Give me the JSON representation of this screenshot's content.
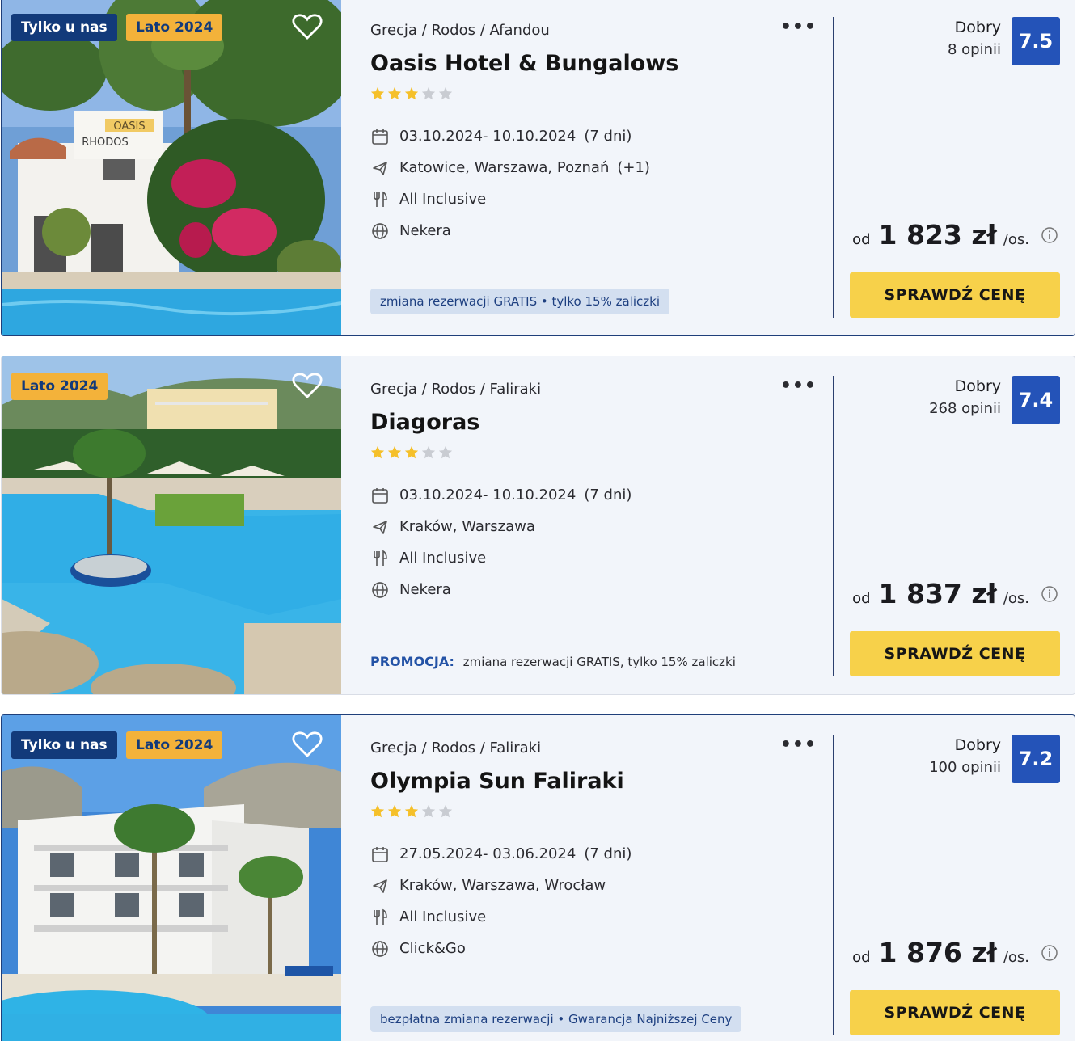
{
  "offers": [
    {
      "badges": {
        "exclusive": "Tylko u nas",
        "season": "Lato 2024"
      },
      "breadcrumb": "Grecja / Rodos / Afandou",
      "name": "Oasis Hotel & Bungalows",
      "stars": 3,
      "dates": "03.10.2024- 10.10.2024",
      "duration": "(7 dni)",
      "departure": "Katowice, Warszawa, Poznań",
      "departure_extra": "(+1)",
      "board": "All Inclusive",
      "operator": "Nekera",
      "promo_text": "zmiana rezerwacji GRATIS • tylko 15% zaliczki",
      "rating_word": "Dobry",
      "rating_count": "8 opinii",
      "score": "7.5",
      "price_prefix": "od",
      "price": "1 823 zł",
      "price_unit": "/os.",
      "cta": "SPRAWDŹ CENĘ",
      "photo_sign_top": "OASIS",
      "photo_sign_bottom": "RHODOS"
    },
    {
      "badges": {
        "season": "Lato 2024"
      },
      "breadcrumb": "Grecja / Rodos / Faliraki",
      "name": "Diagoras",
      "stars": 3,
      "dates": "03.10.2024- 10.10.2024",
      "duration": "(7 dni)",
      "departure": "Kraków, Warszawa",
      "board": "All Inclusive",
      "operator": "Nekera",
      "promo_label": "PROMOCJA:",
      "promo_text": "zmiana rezerwacji GRATIS, tylko 15% zaliczki",
      "rating_word": "Dobry",
      "rating_count": "268 opinii",
      "score": "7.4",
      "price_prefix": "od",
      "price": "1 837 zł",
      "price_unit": "/os.",
      "cta": "SPRAWDŹ CENĘ"
    },
    {
      "badges": {
        "exclusive": "Tylko u nas",
        "season": "Lato 2024"
      },
      "breadcrumb": "Grecja / Rodos / Faliraki",
      "name": "Olympia Sun Faliraki",
      "stars": 3,
      "dates": "27.05.2024- 03.06.2024",
      "duration": "(7 dni)",
      "departure": "Kraków, Warszawa, Wrocław",
      "board": "All Inclusive",
      "operator": "Click&Go",
      "promo_text": "bezpłatna zmiana rezerwacji • Gwarancja Najniższej Ceny",
      "rating_word": "Dobry",
      "rating_count": "100 opinii",
      "score": "7.2",
      "price_prefix": "od",
      "price": "1 876 zł",
      "price_unit": "/os.",
      "cta": "SPRAWDŹ CENĘ"
    }
  ],
  "icons": {
    "favorite": "heart-outline-icon",
    "more": "more-dots-icon",
    "calendar": "calendar-icon",
    "flight": "plane-icon",
    "board": "cutlery-icon",
    "operator": "globe-icon",
    "info": "info-icon",
    "star": "star-icon"
  },
  "colors": {
    "exclusive_badge": "#123a7a",
    "season_badge": "#f3b23a",
    "score_box": "#2453b8",
    "cta": "#f7d14a",
    "promo_pill_bg": "#d3dff0",
    "promo_label": "#2453a6",
    "star_filled": "#f5c02a",
    "star_empty": "#c9ccd2"
  }
}
